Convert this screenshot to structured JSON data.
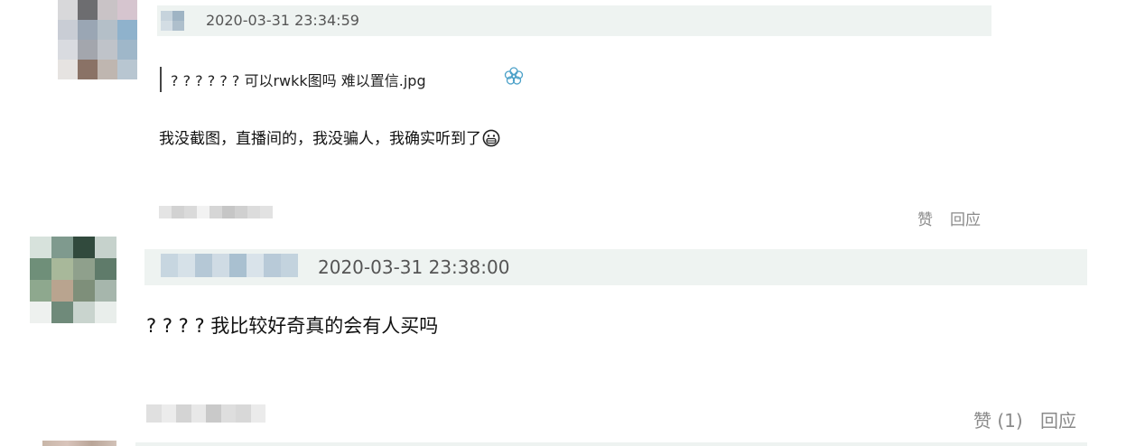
{
  "comments": [
    {
      "timestamp": "2020-03-31 23:34:59",
      "quote": "? ? ? ? ? ? 可以rwkk图吗 难以置信.jpg",
      "quote_icon": "flower-sticker-icon",
      "text": "我没截图，直播间的，我没骗人，我确实听到了",
      "emoji": "grimace-emoji-icon",
      "like_label": "赞",
      "reply_label": "回应"
    },
    {
      "timestamp": "2020-03-31 23:38:00",
      "text": "? ? ? ?  我比较好奇真的会有人买吗",
      "like_label": "赞 (1)",
      "reply_label": "回应"
    }
  ],
  "colors": {
    "header_bg": "#eef3f1",
    "meta_text": "#8a8a8a",
    "accent_icon": "#4aa0c8"
  }
}
